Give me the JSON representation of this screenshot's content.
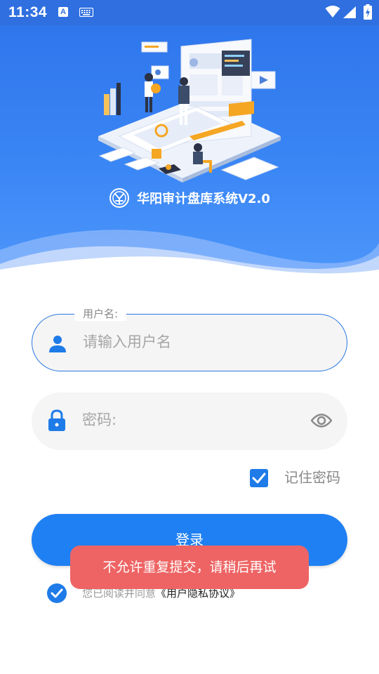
{
  "status_bar": {
    "time": "11:34",
    "icons": [
      "a-notification-icon",
      "keyboard-icon",
      "wifi-icon",
      "signal-icon",
      "battery-charging-icon"
    ]
  },
  "header": {
    "app_title": "华阳审计盘库系统V2.0",
    "logo_icon": "hy-logo-icon"
  },
  "login_form": {
    "username": {
      "label": "用户名:",
      "placeholder": "请输入用户名",
      "icon": "user-icon"
    },
    "password": {
      "placeholder": "密码:",
      "icon": "lock-icon",
      "toggle_icon": "eye-icon"
    },
    "remember_password": {
      "label": "记住密码",
      "checked": true
    },
    "login_button": "登录",
    "agreement": {
      "checked": true,
      "text": "您已阅读并同意",
      "link": "《用户隐私协议》"
    }
  },
  "toast": "不允许重复提交，请稍后再试",
  "colors": {
    "primary": "#1f80f3",
    "header": "#2f76ec",
    "toast": "#ee6464",
    "field_border_active": "#2a78e4"
  }
}
